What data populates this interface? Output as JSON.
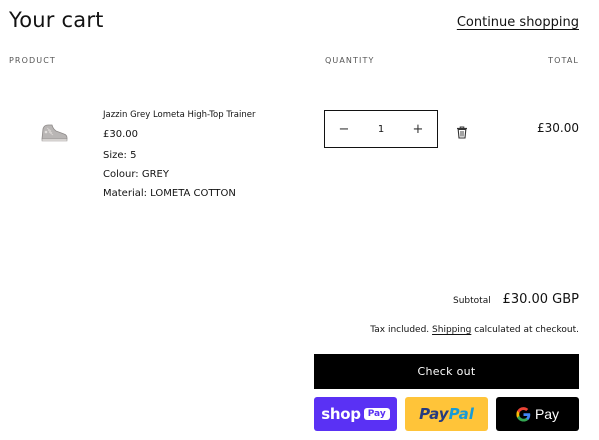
{
  "header": {
    "title": "Your cart",
    "continue_label": "Continue shopping"
  },
  "columns": {
    "product": "PRODUCT",
    "quantity": "QUANTITY",
    "total": "TOTAL"
  },
  "item": {
    "name": "Jazzin Grey Lometa High-Top Trainer",
    "price": "£30.00",
    "size": "Size: 5",
    "colour": "Colour: GREY",
    "material": "Material: LOMETA COTTON",
    "quantity": "1",
    "line_total": "£30.00",
    "thumb_icon": "sneaker-icon",
    "decrease_icon": "minus-icon",
    "increase_icon": "plus-icon",
    "remove_icon": "trash-icon"
  },
  "summary": {
    "subtotal_label": "Subtotal",
    "subtotal_value": "£30.00 GBP",
    "tax_prefix": "Tax included.",
    "tax_link": "Shipping",
    "tax_suffix": "calculated at checkout."
  },
  "actions": {
    "checkout_label": "Check out",
    "shop_pay": {
      "word": "shop",
      "chip": "Pay",
      "color": "#5a31f4"
    },
    "paypal": {
      "pay": "Pay",
      "pal": "Pal",
      "color": "#ffc439"
    },
    "gpay": {
      "text": "Pay",
      "color": "#000000"
    }
  },
  "symbols": {
    "minus": "−",
    "plus": "+"
  }
}
